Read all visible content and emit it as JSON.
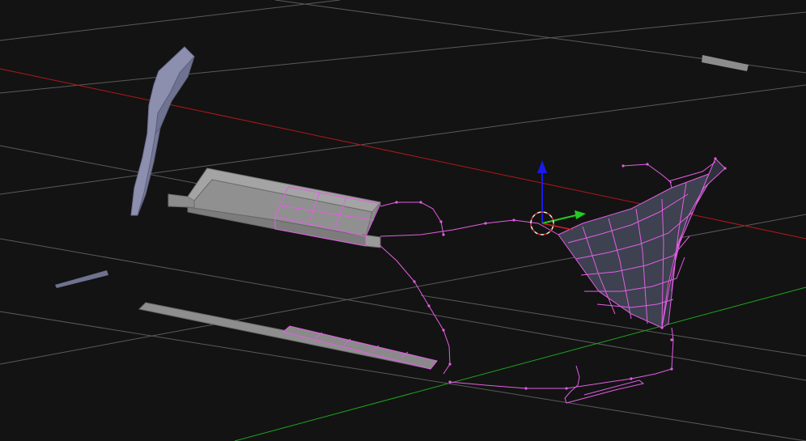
{
  "viewport": {
    "background": "#131313",
    "grid_color": "#5a5a5a",
    "x_axis_color": "#b11818",
    "y_axis_color": "#1fa51f",
    "grid": true
  },
  "colors": {
    "selected_edge": "#e35ee3",
    "selected_face": "#3e4150",
    "mesh_gray": "#8c8c8c",
    "mesh_blue_gray": "#8c8fae",
    "manipulator_z": "#1a1ae6",
    "manipulator_y": "#22cc22",
    "manipulator_x": "#cc2222",
    "cursor_ring": "#f0f0f0"
  },
  "objects": [
    "mirror-blade-mesh",
    "door-trim-channel-mesh",
    "lower-sill-strip-mesh",
    "small-bar-left-mesh",
    "small-bar-right-mesh",
    "front-fender-panel-mesh",
    "selected-edge-curves"
  ],
  "icons": {
    "cursor": "3d-cursor-icon",
    "manipulator": "transform-manipulator-icon"
  }
}
